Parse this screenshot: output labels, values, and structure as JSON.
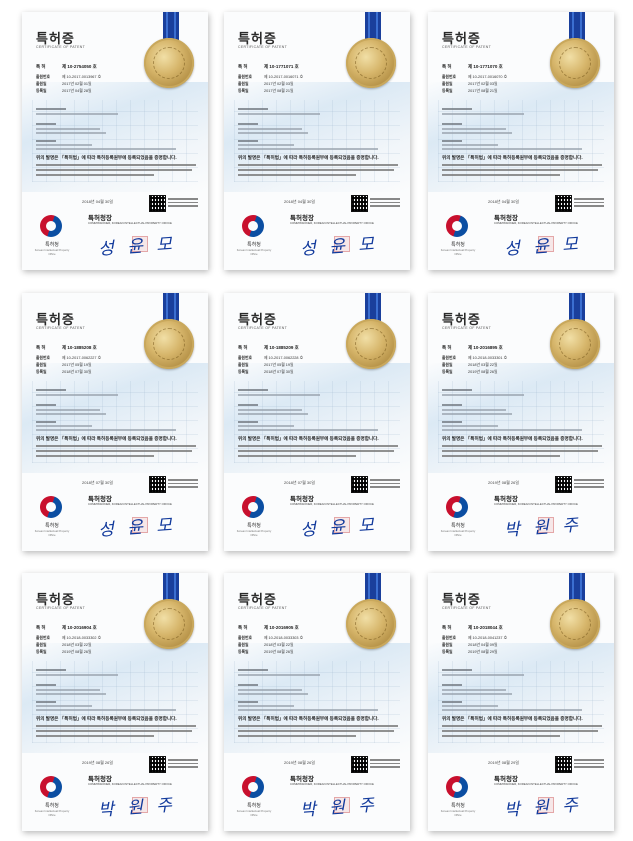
{
  "certificates": [
    {
      "title": "특허증",
      "subtitle": "CERTIFICATE OF PATENT",
      "patent_no": "제 10-2754050 호",
      "application_no": "제 10-2017-0013967 호",
      "app_date": "2017년 02월 01일",
      "reg_date": "2017년 04월 28일",
      "cert_ko": "위의 발명은 「특허법」에 따라 특허등록원부에 등록되었음을 증명합니다.",
      "date": "2018년 04월 30일",
      "commissioner": "특허청장",
      "commissioner_en": "COMMISSIONER, KOREAN INTELLECTUAL PROPERTY OFFICE",
      "signature": "성 윤 모",
      "logo_name": "특허청",
      "logo_en": "Korean Intellectual Property Office"
    },
    {
      "title": "특허증",
      "subtitle": "CERTIFICATE OF PATENT",
      "patent_no": "제 10-1771071 호",
      "application_no": "제 10-2017-0016071 호",
      "app_date": "2017년 02월 03일",
      "reg_date": "2017년 08월 21일",
      "cert_ko": "위의 발명은 「특허법」에 따라 특허등록원부에 등록되었음을 증명합니다.",
      "date": "2018년 04월 30일",
      "commissioner": "특허청장",
      "commissioner_en": "COMMISSIONER, KOREAN INTELLECTUAL PROPERTY OFFICE",
      "signature": "성 윤 모",
      "logo_name": "특허청",
      "logo_en": "Korean Intellectual Property Office"
    },
    {
      "title": "특허증",
      "subtitle": "CERTIFICATE OF PATENT",
      "patent_no": "제 10-1771070 호",
      "application_no": "제 10-2017-0016070 호",
      "app_date": "2017년 02월 03일",
      "reg_date": "2017년 08월 21일",
      "cert_ko": "위의 발명은 「특허법」에 따라 특허등록원부에 등록되었음을 증명합니다.",
      "date": "2018년 04월 30일",
      "commissioner": "특허청장",
      "commissioner_en": "COMMISSIONER, KOREAN INTELLECTUAL PROPERTY OFFICE",
      "signature": "성 윤 모",
      "logo_name": "특허청",
      "logo_en": "Korean Intellectual Property Office"
    },
    {
      "title": "특허증",
      "subtitle": "CERTIFICATE OF PATENT",
      "patent_no": "제 10-1885208 호",
      "application_no": "제 10-2017-0062227 호",
      "app_date": "2017년 05월 19일",
      "reg_date": "2018년 07월 30일",
      "cert_ko": "위의 발명은 「특허법」에 따라 특허등록원부에 등록되었음을 증명합니다.",
      "date": "2018년 07월 30일",
      "commissioner": "특허청장",
      "commissioner_en": "COMMISSIONER, KOREAN INTELLECTUAL PROPERTY OFFICE",
      "signature": "성 윤 모",
      "logo_name": "특허청",
      "logo_en": "Korean Intellectual Property Office"
    },
    {
      "title": "특허증",
      "subtitle": "CERTIFICATE OF PATENT",
      "patent_no": "제 10-1885209 호",
      "application_no": "제 10-2017-0062228 호",
      "app_date": "2017년 05월 19일",
      "reg_date": "2018년 07월 30일",
      "cert_ko": "위의 발명은 「특허법」에 따라 특허등록원부에 등록되었음을 증명합니다.",
      "date": "2018년 07월 30일",
      "commissioner": "특허청장",
      "commissioner_en": "COMMISSIONER, KOREAN INTELLECTUAL PROPERTY OFFICE",
      "signature": "성 윤 모",
      "logo_name": "특허청",
      "logo_en": "Korean Intellectual Property Office"
    },
    {
      "title": "특허증",
      "subtitle": "CERTIFICATE OF PATENT",
      "patent_no": "제 10-2016895 호",
      "application_no": "제 10-2018-0033301 호",
      "app_date": "2018년 03월 22일",
      "reg_date": "2019년 08월 26일",
      "cert_ko": "위의 발명은 「특허법」에 따라 특허등록원부에 등록되었음을 증명합니다.",
      "date": "2019년 08월 26일",
      "commissioner": "특허청장",
      "commissioner_en": "COMMISSIONER, KOREAN INTELLECTUAL PROPERTY OFFICE",
      "signature": "박 원 주",
      "logo_name": "특허청",
      "logo_en": "Korean Intellectual Property Office"
    },
    {
      "title": "특허증",
      "subtitle": "CERTIFICATE OF PATENT",
      "patent_no": "제 10-2016904 호",
      "application_no": "제 10-2018-0033302 호",
      "app_date": "2018년 03월 22일",
      "reg_date": "2019년 08월 26일",
      "cert_ko": "위의 발명은 「특허법」에 따라 특허등록원부에 등록되었음을 증명합니다.",
      "date": "2019년 08월 26일",
      "commissioner": "특허청장",
      "commissioner_en": "COMMISSIONER, KOREAN INTELLECTUAL PROPERTY OFFICE",
      "signature": "박 원 주",
      "logo_name": "특허청",
      "logo_en": "Korean Intellectual Property Office"
    },
    {
      "title": "특허증",
      "subtitle": "CERTIFICATE OF PATENT",
      "patent_no": "제 10-2016905 호",
      "application_no": "제 10-2018-0033303 호",
      "app_date": "2018년 03월 22일",
      "reg_date": "2019년 08월 26일",
      "cert_ko": "위의 발명은 「특허법」에 따라 특허등록원부에 등록되었음을 증명합니다.",
      "date": "2019년 08월 26일",
      "commissioner": "특허청장",
      "commissioner_en": "COMMISSIONER, KOREAN INTELLECTUAL PROPERTY OFFICE",
      "signature": "박 원 주",
      "logo_name": "특허청",
      "logo_en": "Korean Intellectual Property Office"
    },
    {
      "title": "특허증",
      "subtitle": "CERTIFICATE OF PATENT",
      "patent_no": "제 10-2018044 호",
      "application_no": "제 10-2018-0041237 호",
      "app_date": "2018년 04월 09일",
      "reg_date": "2019년 08월 29일",
      "cert_ko": "위의 발명은 「특허법」에 따라 특허등록원부에 등록되었음을 증명합니다.",
      "date": "2019년 08월 29일",
      "commissioner": "특허청장",
      "commissioner_en": "COMMISSIONER, KOREAN INTELLECTUAL PROPERTY OFFICE",
      "signature": "박 원 주",
      "logo_name": "특허청",
      "logo_en": "Korean Intellectual Property Office"
    }
  ],
  "field_labels": {
    "patent": "특 허",
    "application": "출원번호",
    "app_date": "출원일",
    "reg_date": "등록일"
  }
}
